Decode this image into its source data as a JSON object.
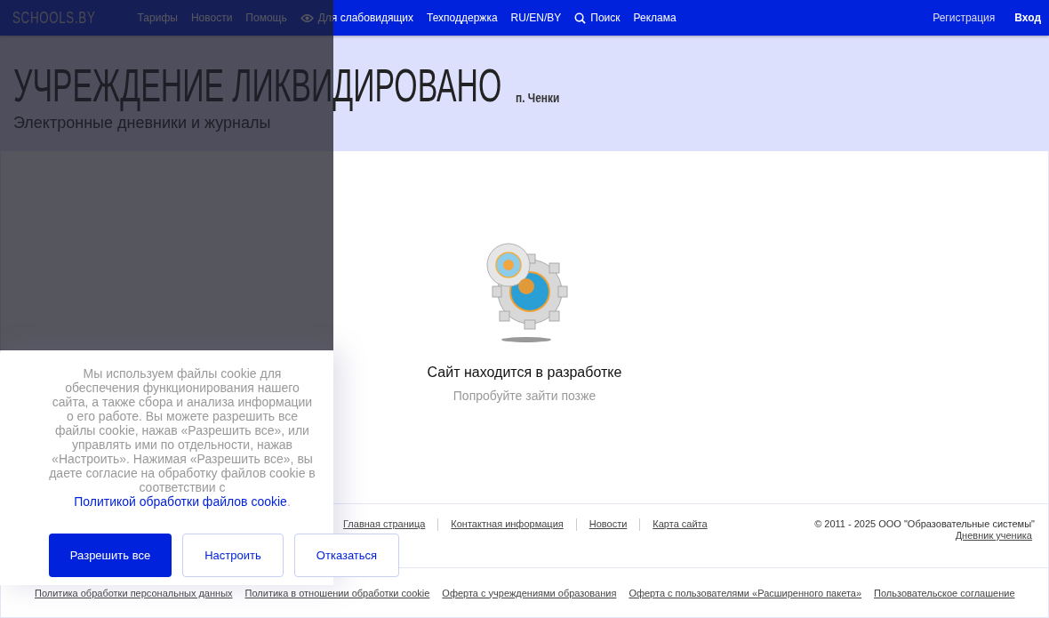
{
  "header": {
    "logo": "SCHOOLS.BY",
    "nav": [
      {
        "kind": "link",
        "label": "Тарифы"
      },
      {
        "kind": "link",
        "label": "Новости"
      },
      {
        "kind": "link",
        "label": "Помощь"
      },
      {
        "kind": "vision",
        "label": "Для слабовидящих"
      },
      {
        "kind": "link",
        "label": "Техподдержка"
      },
      {
        "kind": "link",
        "label": "RU/EN/BY"
      },
      {
        "kind": "search",
        "label": "Поиск"
      },
      {
        "kind": "link",
        "label": "Реклама"
      }
    ],
    "register": "Регистрация",
    "login": "Вход"
  },
  "banner": {
    "title": "УЧРЕЖДЕНИЕ ЛИКВИДИРОВАНО",
    "town": "п. Ченки",
    "subtitle": "Электронные дневники и журналы"
  },
  "status": {
    "title": "Сайт находится в разработке",
    "hint": "Попробуйте зайти позже"
  },
  "footer": {
    "links": [
      "Главная страница",
      "Контактная информация",
      "Новости",
      "Карта сайта"
    ],
    "copyright": "© 2011 - 2025 ООО \"Образовательные системы\"",
    "diary": "Дневник ученика",
    "legal": [
      "Политика обработки персональных данных",
      "Политика в отношении обработки cookie",
      "Оферта с учреждениями образования",
      "Оферта с пользователями «Расширенного пакета»",
      "Пользовательское соглашение"
    ]
  },
  "cookie": {
    "text": "Мы используем файлы cookie для обеспечения функционирования нашего сайта, а также сбора и анализа информации о его работе. Вы можете разрешить все файлы cookie, нажав «Разрешить все», или управлять ими по отдельности, нажав «Настроить». Нажимая «Разрешить все», вы даете согласие на обработку файлов cookie в соответствии с",
    "link": "Политикой обработки файлов cookie",
    "end": ".",
    "buttons": [
      {
        "kind": "primary",
        "label": "Разрешить все"
      },
      {
        "kind": "outline",
        "label": "Настроить"
      },
      {
        "kind": "outline",
        "label": "Отказаться"
      }
    ]
  }
}
